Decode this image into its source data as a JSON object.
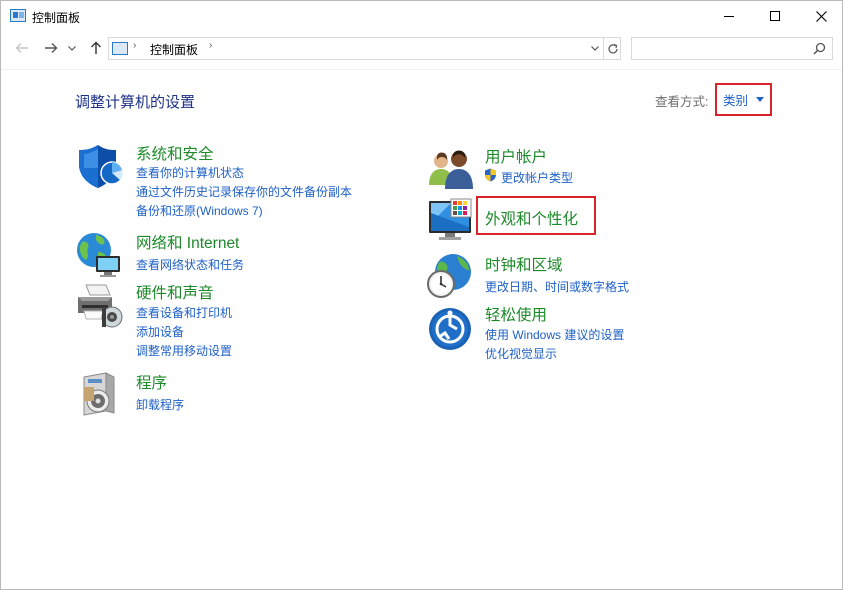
{
  "window": {
    "title": "控制面板"
  },
  "address_bar": {
    "crumb": "控制面板",
    "separator": "›"
  },
  "search": {
    "placeholder": "",
    "value": ""
  },
  "main": {
    "title": "调整计算机的设置",
    "view_by_label": "查看方式:",
    "view_by_value": "类别"
  },
  "categories": [
    {
      "title": "系统和安全",
      "links": [
        "查看你的计算机状态",
        "通过文件历史记录保存你的文件备份副本",
        "备份和还原(Windows 7)"
      ],
      "icon": "shield-icon"
    },
    {
      "title": "网络和 Internet",
      "links": [
        "查看网络状态和任务"
      ],
      "icon": "network-icon"
    },
    {
      "title": "硬件和声音",
      "links": [
        "查看设备和打印机",
        "添加设备",
        "调整常用移动设置"
      ],
      "icon": "printer-icon"
    },
    {
      "title": "程序",
      "links": [
        "卸载程序"
      ],
      "icon": "programs-icon"
    },
    {
      "title": "用户帐户",
      "links": [
        "更改帐户类型"
      ],
      "icon": "users-icon"
    },
    {
      "title": "外观和个性化",
      "links": [],
      "icon": "monitor-icon"
    },
    {
      "title": "时钟和区域",
      "links": [
        "更改日期、时间或数字格式"
      ],
      "icon": "clock-globe-icon"
    },
    {
      "title": "轻松使用",
      "links": [
        "使用 Windows 建议的设置",
        "优化视觉显示"
      ],
      "icon": "ease-of-access-icon"
    }
  ],
  "colors": {
    "category_title": "#1d8a2a",
    "link": "#1e60c8",
    "page_title": "#1e3287",
    "highlight_box": "#d8232a"
  }
}
